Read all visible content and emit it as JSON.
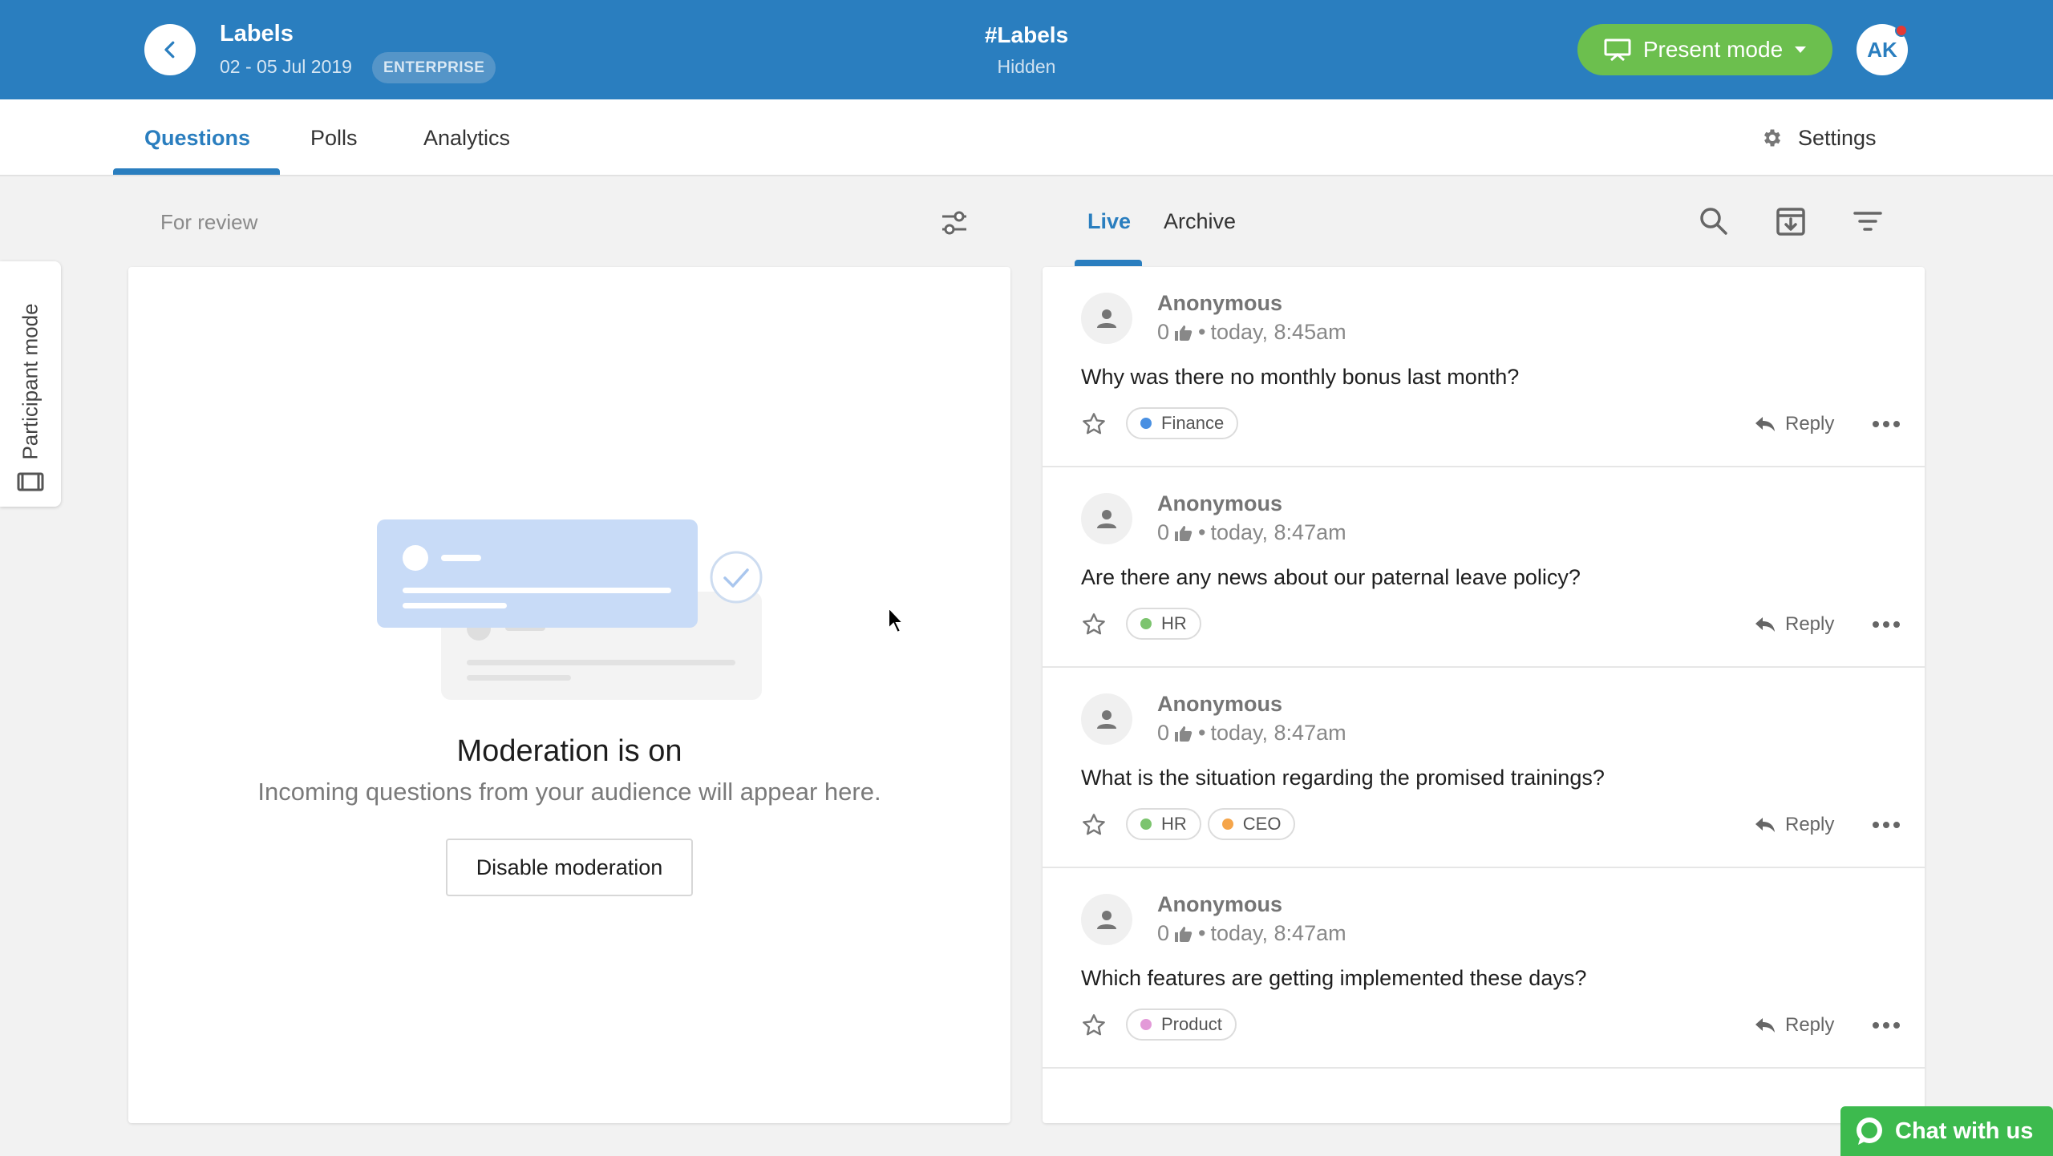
{
  "header": {
    "event_title": "Labels",
    "event_dates": "02 - 05 Jul 2019",
    "plan_badge": "ENTERPRISE",
    "event_code": "#Labels",
    "event_visibility": "Hidden",
    "present_label": "Present mode",
    "avatar_initials": "AK"
  },
  "nav": {
    "tabs": [
      {
        "label": "Questions",
        "active": true
      },
      {
        "label": "Polls",
        "active": false
      },
      {
        "label": "Analytics",
        "active": false
      }
    ],
    "settings_label": "Settings"
  },
  "side_tab": {
    "label": "Participant mode"
  },
  "review": {
    "label": "For review",
    "empty_title": "Moderation is on",
    "empty_desc": "Incoming questions from your audience will appear here.",
    "disable_label": "Disable moderation"
  },
  "live": {
    "tabs": [
      {
        "label": "Live",
        "active": true
      },
      {
        "label": "Archive",
        "active": false
      }
    ],
    "icons": [
      "search-icon",
      "archive-icon",
      "filter-icon"
    ],
    "reply_label": "Reply",
    "questions": [
      {
        "author": "Anonymous",
        "likes": "0",
        "time": "today, 8:45am",
        "text": "Why was there no monthly bonus last month?",
        "labels": [
          {
            "name": "Finance",
            "color": "#4a90e2"
          }
        ]
      },
      {
        "author": "Anonymous",
        "likes": "0",
        "time": "today, 8:47am",
        "text": "Are there any news about our paternal leave policy?",
        "labels": [
          {
            "name": "HR",
            "color": "#7cc46e"
          }
        ]
      },
      {
        "author": "Anonymous",
        "likes": "0",
        "time": "today, 8:47am",
        "text": "What is the situation regarding the promised trainings?",
        "labels": [
          {
            "name": "HR",
            "color": "#7cc46e"
          },
          {
            "name": "CEO",
            "color": "#f5a54a"
          }
        ]
      },
      {
        "author": "Anonymous",
        "likes": "0",
        "time": "today, 8:47am",
        "text": "Which features are getting implemented these days?",
        "labels": [
          {
            "name": "Product",
            "color": "#e39ad8"
          }
        ]
      }
    ]
  },
  "chat": {
    "label": "Chat with us"
  },
  "colors": {
    "brand": "#2a7ebf",
    "present": "#6cbf4e",
    "chat": "#3dba4e"
  }
}
